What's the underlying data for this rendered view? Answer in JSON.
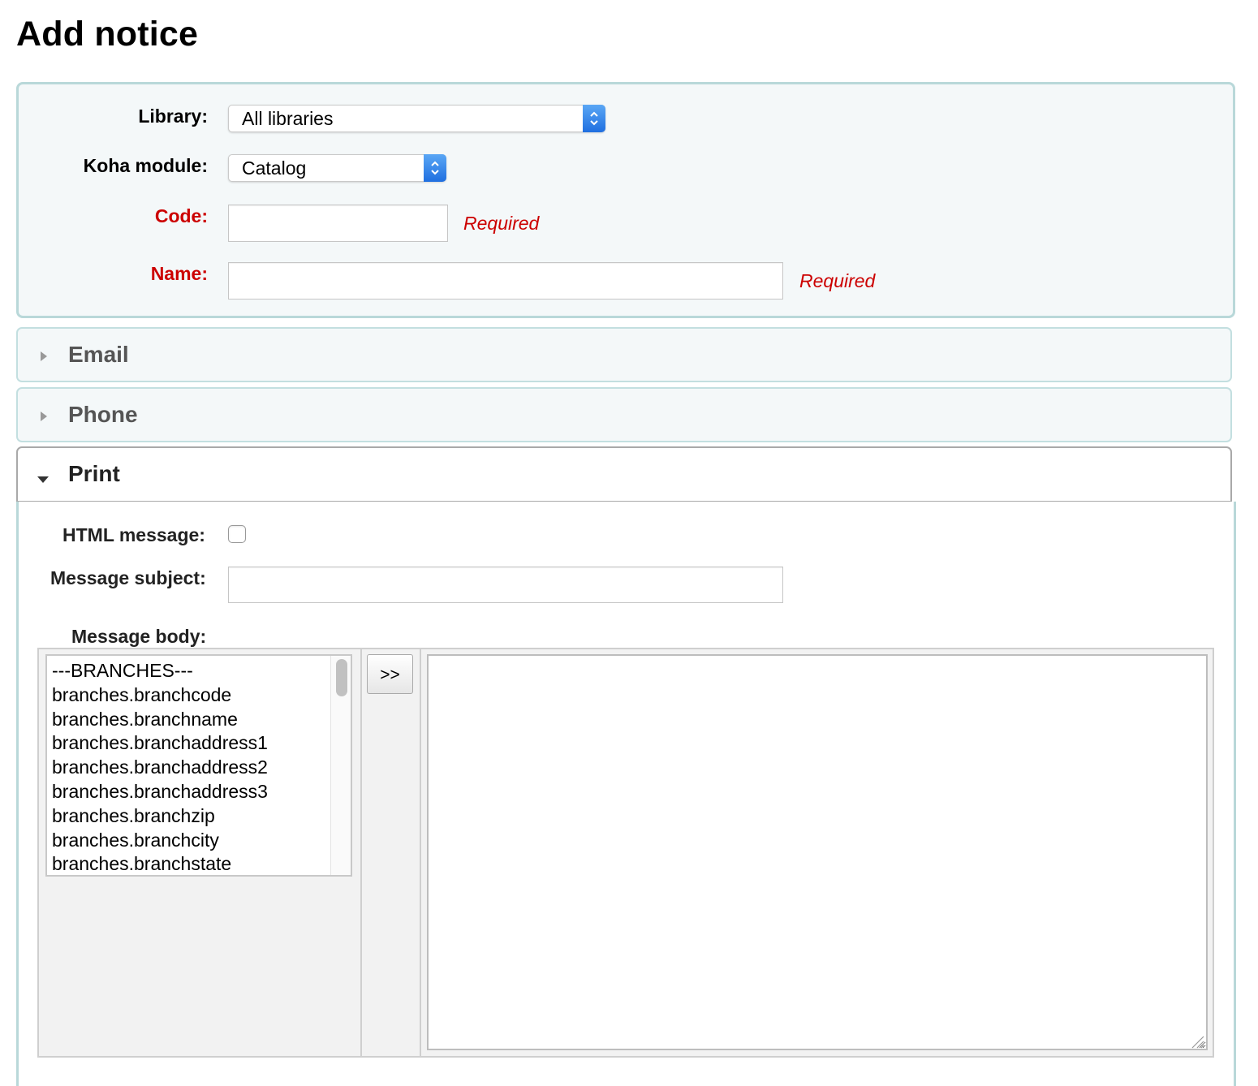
{
  "page": {
    "title": "Add notice"
  },
  "form": {
    "library": {
      "label": "Library:",
      "value": "All libraries"
    },
    "module": {
      "label": "Koha module:",
      "value": "Catalog"
    },
    "code": {
      "label": "Code:",
      "value": "",
      "note": "Required"
    },
    "name": {
      "label": "Name:",
      "value": "",
      "note": "Required"
    }
  },
  "sections": {
    "email": {
      "title": "Email",
      "expanded": false
    },
    "phone": {
      "title": "Phone",
      "expanded": false
    },
    "print": {
      "title": "Print",
      "expanded": true
    }
  },
  "print": {
    "html_message_label": "HTML message:",
    "html_message_checked": false,
    "subject_label": "Message subject:",
    "subject_value": "",
    "body_label": "Message body:",
    "insert_button": ">>",
    "body_value": "",
    "fields": [
      "---BRANCHES---",
      "branches.branchcode",
      "branches.branchname",
      "branches.branchaddress1",
      "branches.branchaddress2",
      "branches.branchaddress3",
      "branches.branchzip",
      "branches.branchcity",
      "branches.branchstate"
    ]
  },
  "colors": {
    "required": "#cc0000",
    "panel_border": "#b9d8d9",
    "panel_background": "#f4f8f9",
    "select_accent": "#1f6fe0"
  },
  "icons": {
    "collapsed": "triangle-right-icon",
    "expanded": "triangle-down-icon",
    "select": "updown-chevrons-icon",
    "resize": "resize-grip-icon"
  }
}
